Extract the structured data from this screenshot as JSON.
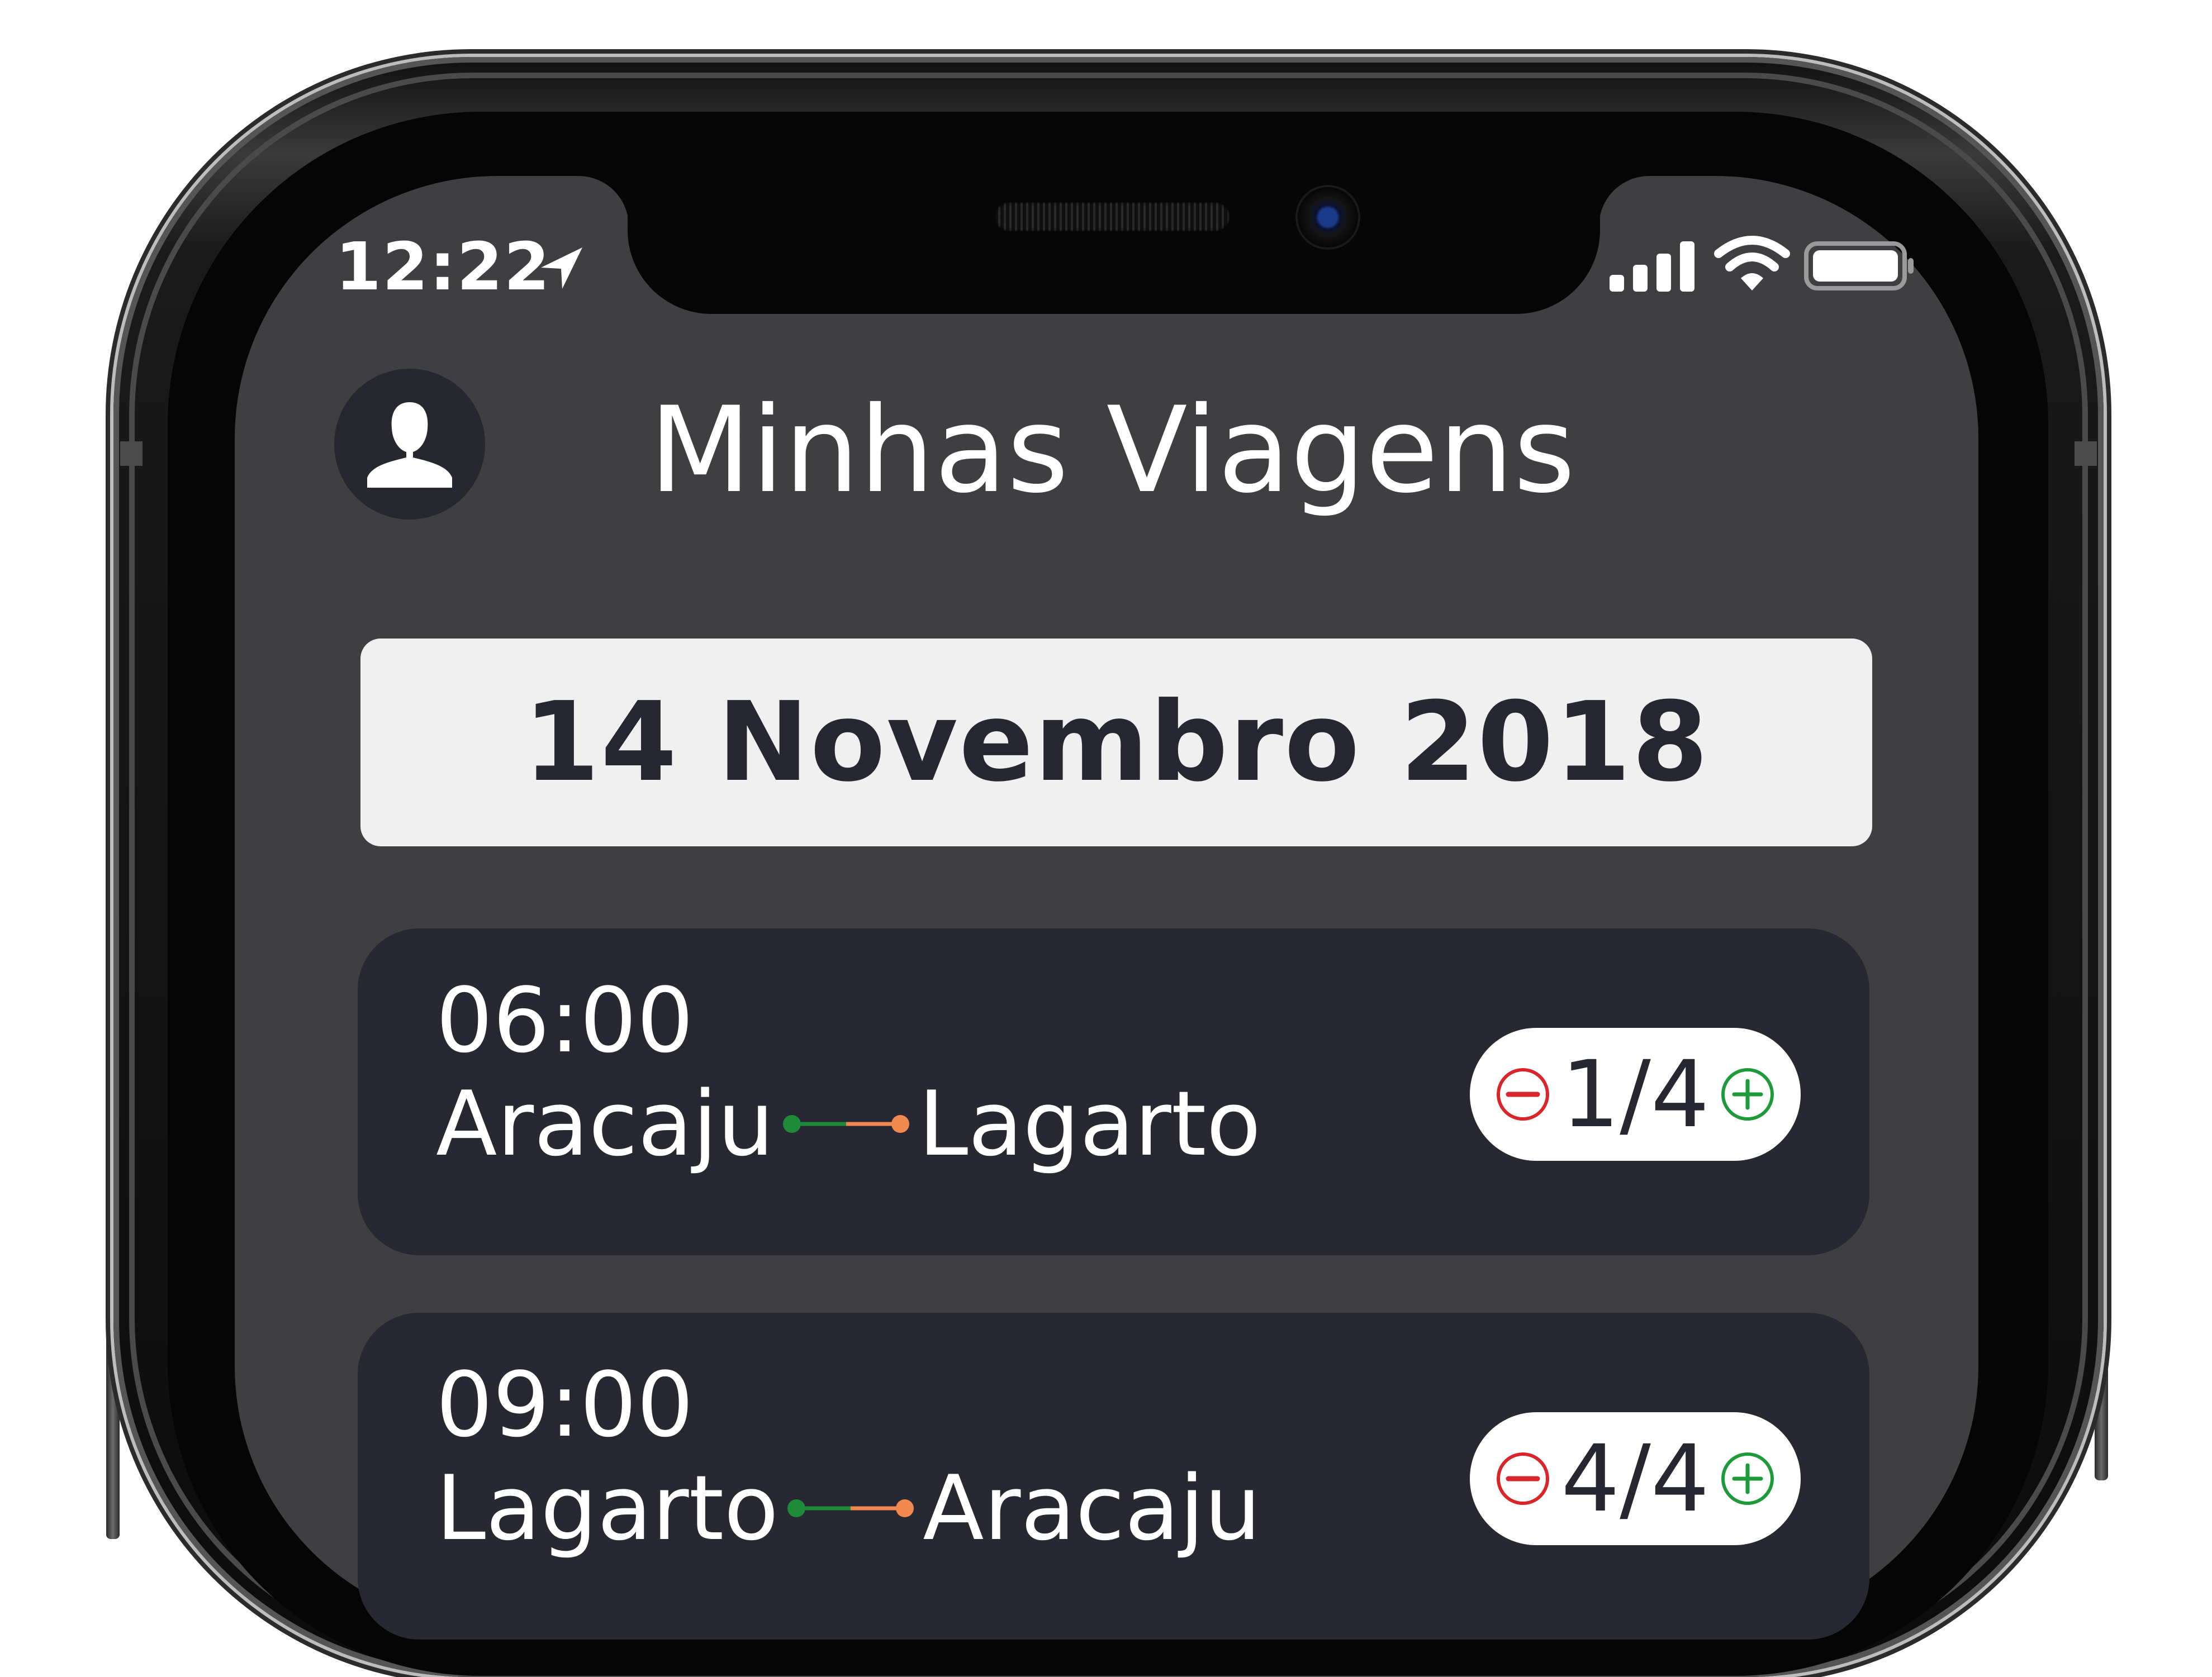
{
  "status_bar": {
    "time": "12:22"
  },
  "header": {
    "title": "Minhas Viagens"
  },
  "date_banner": {
    "label": "14 Novembro 2018"
  },
  "trips": [
    {
      "time": "06:00",
      "origin": "Aracaju",
      "destination": "Lagarto",
      "seats": "1/4"
    },
    {
      "time": "09:00",
      "origin": "Lagarto",
      "destination": "Aracaju",
      "seats": "4/4"
    }
  ],
  "icons": {
    "avatar": "user-silhouette-icon",
    "location": "location-arrow-icon",
    "signal": "cellular-signal-icon",
    "wifi": "wifi-icon",
    "battery": "battery-icon",
    "minus": "minus-circle-icon",
    "plus": "plus-circle-icon"
  },
  "colors": {
    "screen_bg": "#3f3f41",
    "card_bg": "#272831",
    "banner_bg": "#f0f0f1",
    "route_origin": "#1e8a3a",
    "route_destination": "#f0884f",
    "minus": "#d9262b",
    "plus": "#1e9a3a"
  }
}
